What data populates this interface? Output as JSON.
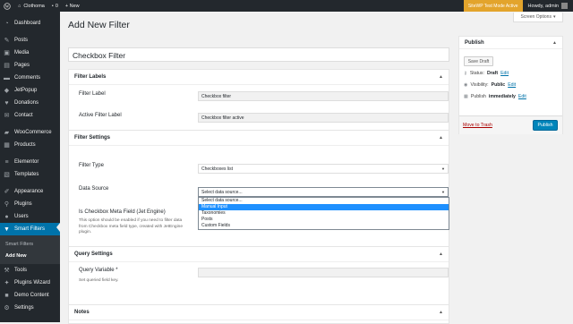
{
  "adminbar": {
    "site_name": "Clothoma",
    "comments_count": "0",
    "new_label": "+ New",
    "test_mode": "SiteWP Test Mode Active",
    "howdy": "Howdy, admin"
  },
  "sidebar": {
    "items": [
      {
        "label": "Dashboard",
        "icon": "dashboard-icon"
      },
      {
        "label": "Posts",
        "icon": "pin-icon"
      },
      {
        "label": "Media",
        "icon": "media-icon"
      },
      {
        "label": "Pages",
        "icon": "page-icon"
      },
      {
        "label": "Comments",
        "icon": "comment-icon"
      },
      {
        "label": "JetPopup",
        "icon": "jetpopup-icon"
      },
      {
        "label": "Donations",
        "icon": "donations-icon"
      },
      {
        "label": "Contact",
        "icon": "mail-icon"
      },
      {
        "label": "WooCommerce",
        "icon": "woocommerce-icon"
      },
      {
        "label": "Products",
        "icon": "products-icon"
      },
      {
        "label": "Elementor",
        "icon": "elementor-icon"
      },
      {
        "label": "Templates",
        "icon": "templates-icon"
      },
      {
        "label": "Appearance",
        "icon": "brush-icon"
      },
      {
        "label": "Plugins",
        "icon": "plugin-icon"
      },
      {
        "label": "Users",
        "icon": "user-icon"
      },
      {
        "label": "Smart Filters",
        "icon": "filter-icon"
      },
      {
        "label": "Tools",
        "icon": "wrench-icon"
      },
      {
        "label": "Plugins Wizard",
        "icon": "wizard-icon"
      },
      {
        "label": "Demo Content",
        "icon": "demo-icon"
      },
      {
        "label": "Settings",
        "icon": "settings-icon"
      }
    ],
    "submenu": [
      "Smart Filters",
      "Add New"
    ]
  },
  "page": {
    "title": "Add New Filter",
    "screen_options": "Screen Options",
    "filter_title": "Checkbox Filter"
  },
  "filter_labels": {
    "heading": "Filter Labels",
    "filter_label": "Filter Label",
    "filter_label_value": "Checkbox filter",
    "active_label": "Active Filter Label",
    "active_label_value": "Checkbox filter active"
  },
  "filter_settings": {
    "heading": "Filter Settings",
    "filter_type_label": "Filter Type",
    "filter_type_value": "Checkboxes list",
    "data_source_label": "Data Source",
    "data_source_value": "Select data source...",
    "options": [
      "Select data source...",
      "Manual Input",
      "Taxonomies",
      "Posts",
      "Custom Fields"
    ],
    "highlighted_option": "Manual Input",
    "meta_field_label": "Is Checkbox Meta Field (Jet Engine)",
    "meta_field_desc": "This option should be enabled if you need to filter data from Checkbox meta field type, created with JetEngine plugin."
  },
  "query_settings": {
    "heading": "Query Settings",
    "query_variable_label": "Query Variable *",
    "query_variable_desc": "Set queried field key."
  },
  "notes": {
    "heading": "Notes"
  },
  "publish": {
    "heading": "Publish",
    "save_draft": "Save Draft",
    "status_label": "Status:",
    "status_value": "Draft",
    "visibility_label": "Visibility:",
    "visibility_value": "Public",
    "publish_label": "Publish",
    "publish_value": "immediately",
    "edit": "Edit",
    "trash": "Move to Trash",
    "publish_button": "Publish"
  },
  "colors": {
    "adminbar": "#23282d",
    "accent": "#0073aa",
    "test_mode": "#e3a42c",
    "primary_button": "#0085ba"
  }
}
